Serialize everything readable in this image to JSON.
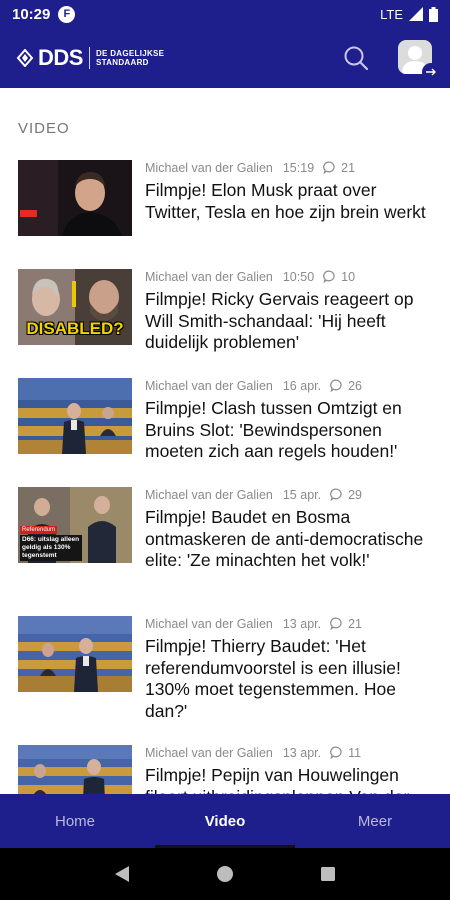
{
  "status_bar": {
    "time": "10:29",
    "app_icon_letter": "F",
    "network": "LTE"
  },
  "header": {
    "logo_text": "DDS",
    "logo_sub_line1": "DE DAGELIJKSE",
    "logo_sub_line2": "STANDAARD",
    "brand_color": "#1e1e8c"
  },
  "section": {
    "title": "VIDEO"
  },
  "articles": [
    {
      "author": "Michael van der Galien",
      "time": "15:19",
      "comments": "21",
      "title": "Filmpje! Elon Musk praat over Twitter, Tesla en hoe zijn brein werkt"
    },
    {
      "author": "Michael van der Galien",
      "time": "10:50",
      "comments": "10",
      "title": "Filmpje! Ricky Gervais reageert op Will Smith-schandaal: 'Hij heeft duidelijk problemen'",
      "thumb_caption": "DISABLED?"
    },
    {
      "author": "Michael van der Galien",
      "time": "16 apr.",
      "comments": "26",
      "title": "Filmpje! Clash tussen Omtzigt en Bruins Slot: 'Bewindspersonen moeten zich aan regels houden!'"
    },
    {
      "author": "Michael van der Galien",
      "time": "15 apr.",
      "comments": "29",
      "title": "Filmpje! Baudet en Bosma ontmaskeren de anti-democratische elite: 'Ze minachten het volk!'",
      "thumb_tag": "Referendum",
      "thumb_caption": "D66: uitslag alleen geldig als 130% tegenstemt"
    },
    {
      "author": "Michael van der Galien",
      "time": "13 apr.",
      "comments": "21",
      "title": "Filmpje! Thierry Baudet: 'Het referendumvoorstel  is een illusie! 130% moet tegenstemmen. Hoe dan?'"
    },
    {
      "author": "Michael van der Galien",
      "time": "13 apr.",
      "comments": "11",
      "title": "Filmpje! Pepijn van Houwelingen fileert uitbreidingsplannen Van der"
    }
  ],
  "bottom_nav": {
    "items": [
      {
        "label": "Home"
      },
      {
        "label": "Video"
      },
      {
        "label": "Meer"
      }
    ],
    "active": "Video"
  }
}
